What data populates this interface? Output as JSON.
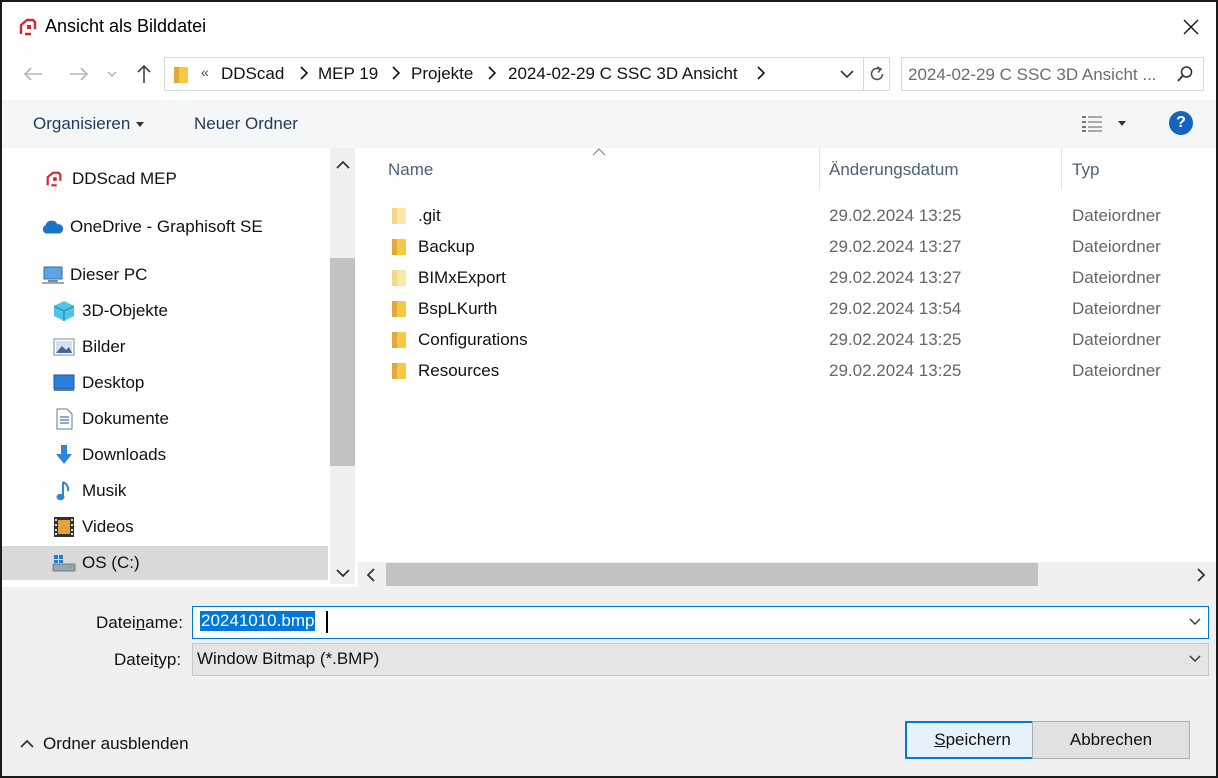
{
  "window": {
    "title": "Ansicht als Bilddatei",
    "accent_color": "#0078d7",
    "app_icon": "ddscad-logo-icon"
  },
  "address": {
    "overflow_marker": "«",
    "breadcrumbs": [
      "DDScad",
      "MEP 19",
      "Projekte",
      "2024-02-29 C SSC 3D Ansicht"
    ]
  },
  "search": {
    "placeholder": "2024-02-29 C SSC 3D Ansicht ..."
  },
  "toolbar": {
    "organize_label": "Organisieren",
    "new_folder_label": "Neuer Ordner",
    "help_label": "?"
  },
  "nav": {
    "items": [
      {
        "label": "DDScad MEP",
        "icon": "ddscad-logo-icon"
      },
      {
        "label": "OneDrive - Graphisoft SE",
        "icon": "onedrive-cloud-icon"
      },
      {
        "label": "Dieser PC",
        "icon": "computer-icon"
      },
      {
        "label": "3D-Objekte",
        "icon": "cube-icon"
      },
      {
        "label": "Bilder",
        "icon": "pictures-icon"
      },
      {
        "label": "Desktop",
        "icon": "desktop-icon"
      },
      {
        "label": "Dokumente",
        "icon": "documents-icon"
      },
      {
        "label": "Downloads",
        "icon": "download-arrow-icon"
      },
      {
        "label": "Musik",
        "icon": "music-note-icon"
      },
      {
        "label": "Videos",
        "icon": "film-icon"
      },
      {
        "label": "OS (C:)",
        "icon": "windows-drive-icon"
      }
    ]
  },
  "files": {
    "columns": [
      "Name",
      "Änderungsdatum",
      "Typ"
    ],
    "rows": [
      {
        "name": ".git",
        "date": "29.02.2024 13:25",
        "type": "Dateiordner"
      },
      {
        "name": "Backup",
        "date": "29.02.2024 13:27",
        "type": "Dateiordner"
      },
      {
        "name": "BIMxExport",
        "date": "29.02.2024 13:27",
        "type": "Dateiordner"
      },
      {
        "name": "BspLKurth",
        "date": "29.02.2024 13:54",
        "type": "Dateiordner"
      },
      {
        "name": "Configurations",
        "date": "29.02.2024 13:25",
        "type": "Dateiordner"
      },
      {
        "name": "Resources",
        "date": "29.02.2024 13:25",
        "type": "Dateiordner"
      }
    ]
  },
  "form": {
    "filename_label_pre": "Datei",
    "filename_label_accel": "n",
    "filename_label_post": "ame:",
    "filename_value": "20241010.bmp",
    "filetype_label_pre": "Datei",
    "filetype_label_accel": "t",
    "filetype_label_post": "yp:",
    "filetype_value": "Window Bitmap (*.BMP)"
  },
  "footer": {
    "hide_folders_label": "Ordner ausblenden",
    "save_accel": "S",
    "save_rest": "peichern",
    "cancel_label": "Abbrechen"
  }
}
